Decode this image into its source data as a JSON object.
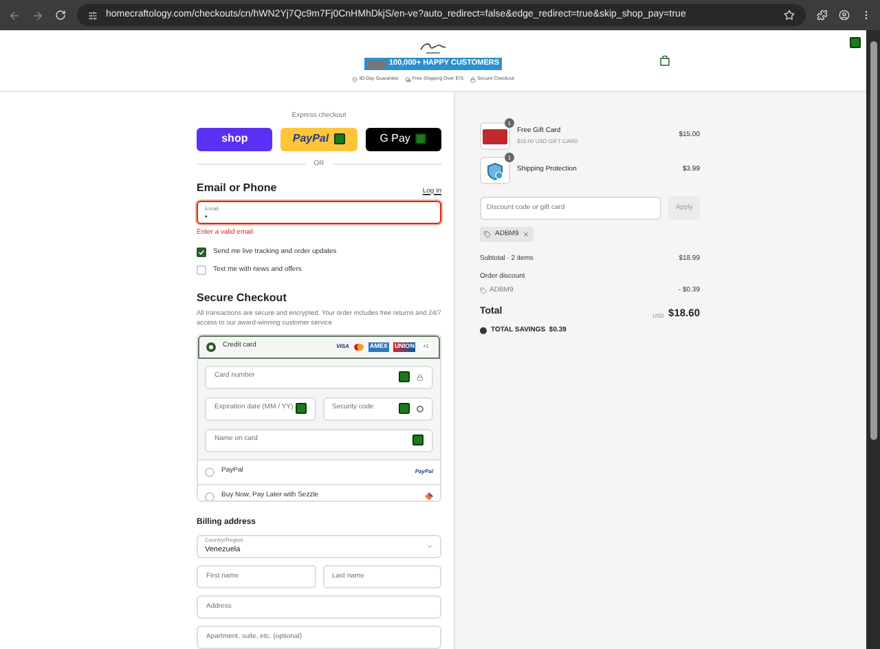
{
  "browser": {
    "url": "homecraftology.com/checkouts/cn/hWN2Yj7Qc9m7Fj0CnHMhDkjS/en-ve?auto_redirect=false&edge_redirect=true&skip_shop_pay=true"
  },
  "header": {
    "banner": "100,000+ HAPPY CUSTOMERS",
    "badges": [
      "30-Day Guarantee",
      "Free Shipping Over $75",
      "Secure Checkout"
    ]
  },
  "express": {
    "label": "Express checkout",
    "buttons": [
      {
        "kind": "shop",
        "label": "shop"
      },
      {
        "kind": "paypal",
        "label": "PayPal"
      },
      {
        "kind": "gpay",
        "label": "G Pay"
      }
    ],
    "divider": "OR"
  },
  "contact": {
    "title": "Email or Phone",
    "login": "Log in",
    "field": {
      "label": "Email",
      "value": "•",
      "invalid": true
    },
    "error": "Enter a valid email",
    "options": [
      {
        "label": "Send me live tracking and order updates",
        "checked": true
      },
      {
        "label": "Text me with news and offers",
        "checked": false
      }
    ]
  },
  "payment": {
    "title": "Secure Checkout",
    "description": "All transactions are secure and encrypted. Your order includes free returns and 24/7 access to our award-winning customer service",
    "methods": [
      {
        "kind": "card",
        "label": "Credit card",
        "selected": true,
        "brands": [
          "VISA",
          "AMEX",
          "UNION"
        ],
        "more": "+1"
      },
      {
        "kind": "paypal",
        "label": "PayPal",
        "selected": false,
        "logo": "PayPal"
      },
      {
        "kind": "sezzle",
        "label": "Buy Now, Pay Later with Sezzle",
        "selected": false
      }
    ],
    "card_fields": {
      "number": "Card number",
      "expiry": "Expiration date (MM / YY)",
      "security": "Security code",
      "name": "Name on card"
    }
  },
  "billing": {
    "title": "Billing address",
    "country": {
      "label": "Country/Region",
      "value": "Venezuela"
    },
    "fields": [
      {
        "placeholder": "First name"
      },
      {
        "placeholder": "Last name"
      },
      {
        "placeholder": "Address"
      },
      {
        "placeholder": "Apartment, suite, etc. (optional)"
      }
    ]
  },
  "order": {
    "items": [
      {
        "kind": "gift",
        "name": "Free Gift Card",
        "detail": "$15.00 USD GIFT CARD",
        "quantity": "1",
        "price": "$15.00"
      },
      {
        "kind": "shield",
        "name": "Shipping Protection",
        "quantity": "1",
        "price": "$3.99"
      }
    ],
    "discount": {
      "placeholder": "Discount code or gift card",
      "button": "Apply",
      "code": "ADBM9"
    },
    "subtotal": {
      "label": "Subtotal · 2 items",
      "value": "$18.99"
    },
    "order_discount": {
      "label": "Order discount",
      "code": "ADBM9",
      "value": "- $0.39"
    },
    "total": {
      "label": "Total",
      "currency": "USD",
      "value": "$18.60"
    },
    "savings": "TOTAL SAVINGS  $0.39"
  }
}
